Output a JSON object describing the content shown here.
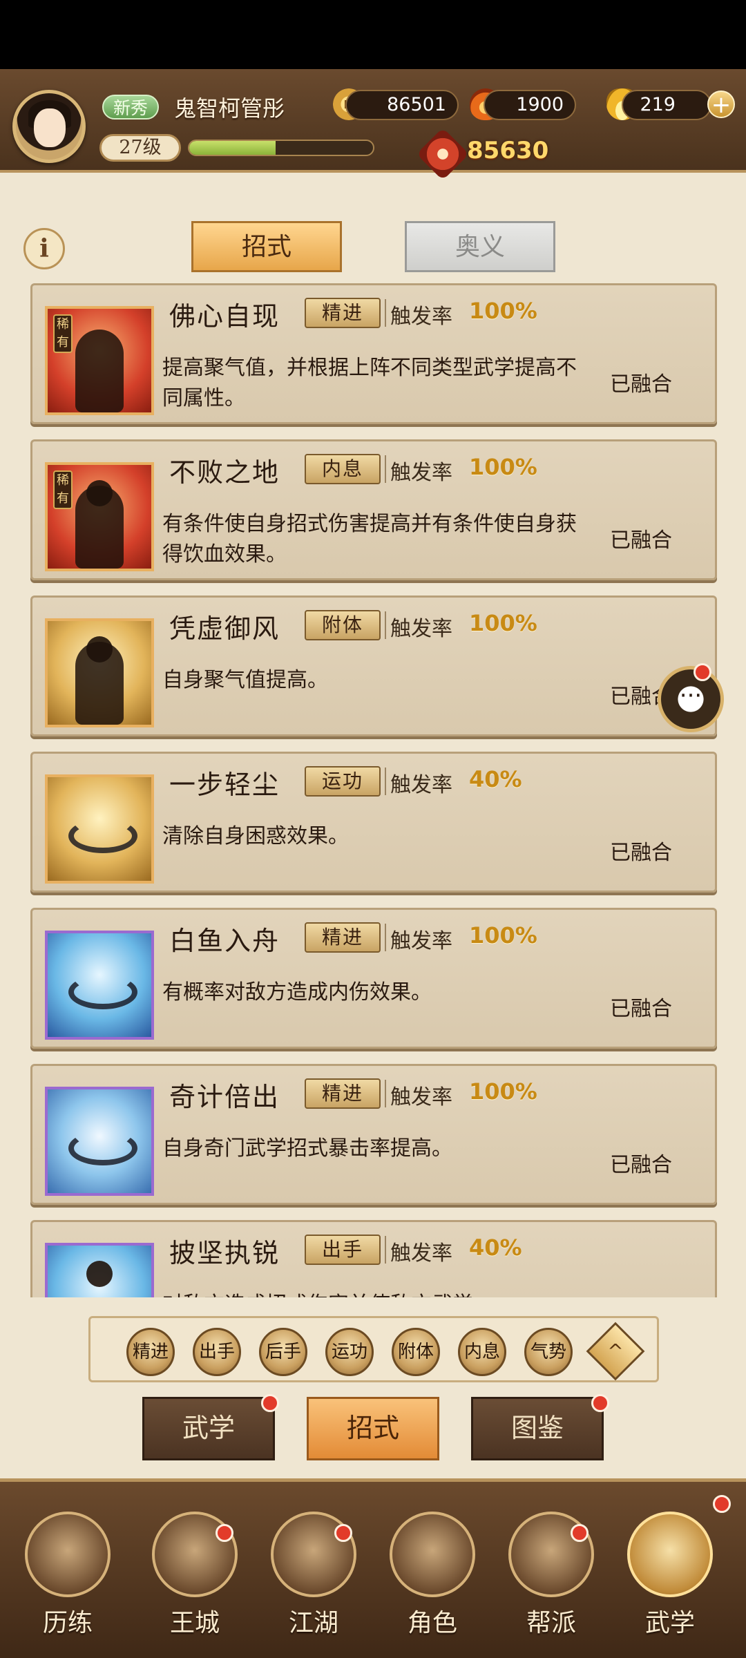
{
  "header": {
    "player": {
      "badge": "新秀",
      "name": "鬼智柯管彤",
      "level": "27级",
      "xp_fraction": 0.47
    },
    "resources": [
      {
        "icon": "coin-icon",
        "value": "86501"
      },
      {
        "icon": "fire-icon",
        "value": "1900"
      },
      {
        "icon": "gold-ingot-icon",
        "value": "219"
      }
    ],
    "power": "85630"
  },
  "tabs": {
    "active": "招式",
    "inactive": "奥义"
  },
  "skills": [
    {
      "title": "佛心自现",
      "type": "精进",
      "rate_label": "触发率",
      "rate": "100%",
      "desc": "提高聚气值，并根据上阵不同类型武学提高不同属性。",
      "status": "已融合",
      "rare": "稀有"
    },
    {
      "title": "不败之地",
      "type": "内息",
      "rate_label": "触发率",
      "rate": "100%",
      "desc": "有条件使自身招式伤害提高并有条件使自身获得饮血效果。",
      "status": "已融合",
      "rare": "稀有"
    },
    {
      "title": "凭虚御风",
      "type": "附体",
      "rate_label": "触发率",
      "rate": "100%",
      "desc": "自身聚气值提高。",
      "status": "已融合"
    },
    {
      "title": "一步轻尘",
      "type": "运功",
      "rate_label": "触发率",
      "rate": "40%",
      "desc": "清除自身困惑效果。",
      "status": "已融合"
    },
    {
      "title": "白鱼入舟",
      "type": "精进",
      "rate_label": "触发率",
      "rate": "100%",
      "desc": "有概率对敌方造成内伤效果。",
      "status": "已融合"
    },
    {
      "title": "奇计倍出",
      "type": "精进",
      "rate_label": "触发率",
      "rate": "100%",
      "desc": "自身奇门武学招式暴击率提高。",
      "status": "已融合"
    },
    {
      "title": "披坚执锐",
      "type": "出手",
      "rate_label": "触发率",
      "rate": "40%",
      "desc": "对敌方造成招式伤害并使敌方武学",
      "status": ""
    }
  ],
  "filters": [
    "精进",
    "出手",
    "后手",
    "运功",
    "附体",
    "内息",
    "气势"
  ],
  "subtabs": [
    "武学",
    "招式",
    "图鉴"
  ],
  "nav": [
    "历练",
    "王城",
    "江湖",
    "角色",
    "帮派",
    "武学"
  ]
}
